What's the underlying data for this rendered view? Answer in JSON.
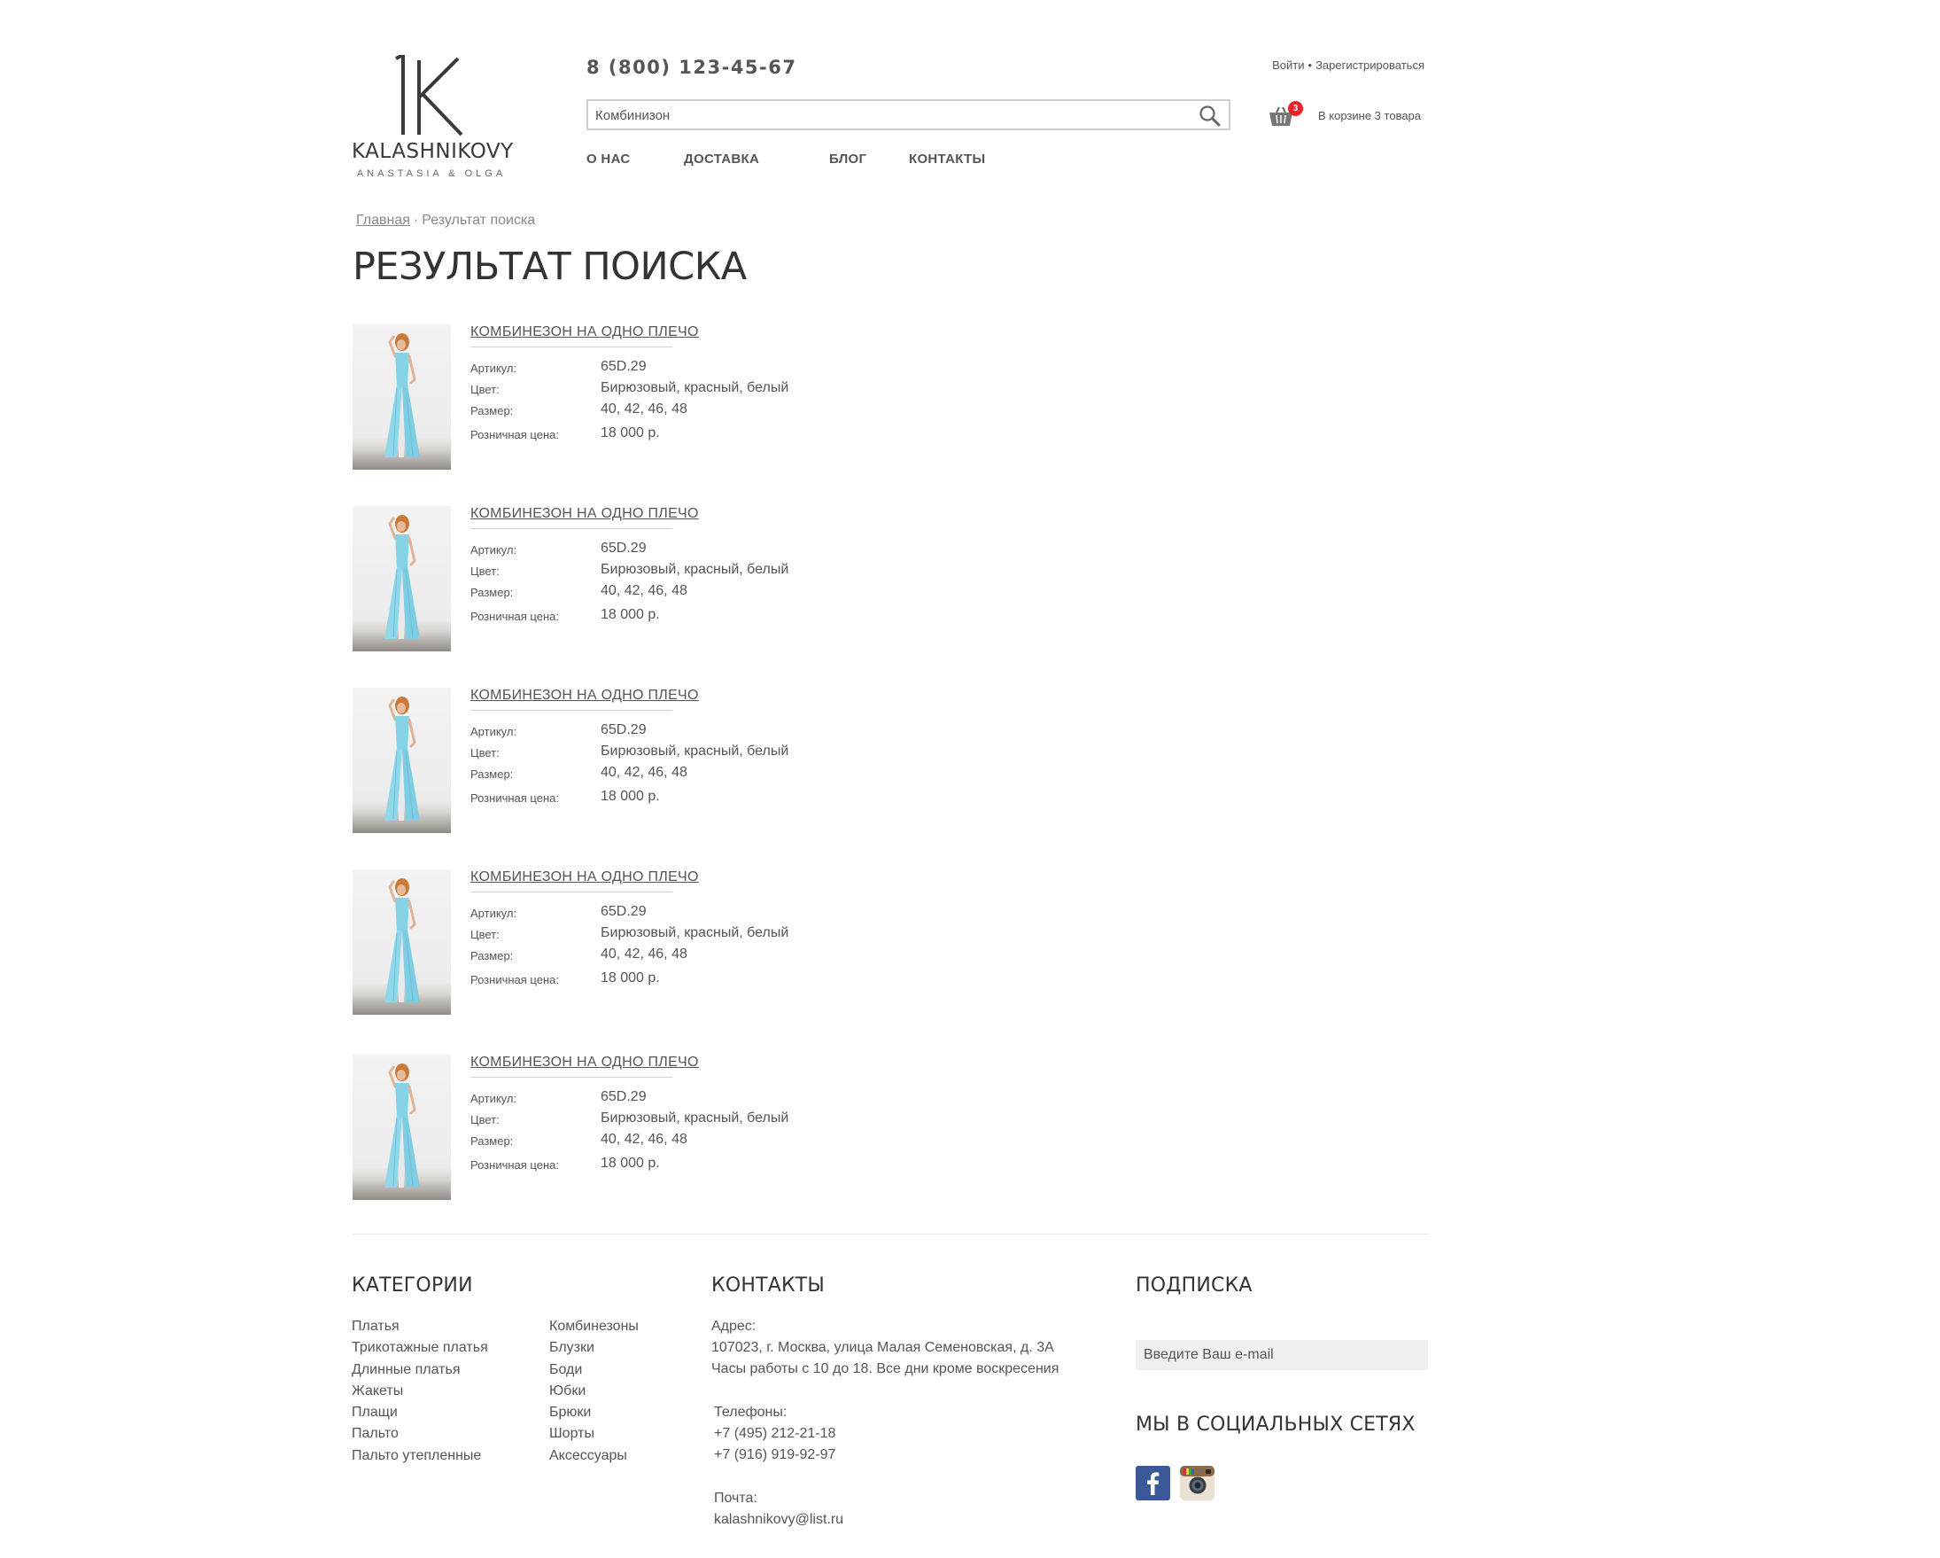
{
  "header": {
    "logo": {
      "name": "KALASHNIKOVY",
      "subtitle": "ANASTASIA & OLGA"
    },
    "phone": "8 (800) 123-45-67",
    "search": {
      "value": "Комбинизон",
      "icon": "search-icon"
    },
    "nav": [
      "О НАС",
      "ДОСТАВКА",
      "БЛОГ",
      "КОНТАКТЫ"
    ],
    "auth": {
      "login": "Войти",
      "separator": "•",
      "register": "Зарегистрироваться"
    },
    "cart": {
      "count": "3",
      "label": "В корзине 3 товара",
      "icon": "basket-icon",
      "badge_color": "#e8232a"
    }
  },
  "breadcrumb": {
    "home": "Главная",
    "separator": "·",
    "current": "Результат поиска"
  },
  "page_title": "РЕЗУЛЬТАТ ПОИСКА",
  "labels": {
    "article": "Артикул:",
    "color": "Цвет:",
    "size": "Размер:",
    "price": "Розничная цена:"
  },
  "products": [
    {
      "title": "КОМБИНЕЗОН НА ОДНО ПЛЕЧО",
      "article": "65D.29",
      "color": "Бирюзовый, красный, белый",
      "size": "40, 42, 46, 48",
      "price": "18 000 р."
    },
    {
      "title": "КОМБИНЕЗОН НА ОДНО ПЛЕЧО",
      "article": "65D.29",
      "color": "Бирюзовый, красный, белый",
      "size": "40, 42, 46, 48",
      "price": "18 000 р."
    },
    {
      "title": "КОМБИНЕЗОН НА ОДНО ПЛЕЧО",
      "article": "65D.29",
      "color": "Бирюзовый, красный, белый",
      "size": "40, 42, 46, 48",
      "price": "18 000 р."
    },
    {
      "title": "КОМБИНЕЗОН НА ОДНО ПЛЕЧО",
      "article": "65D.29",
      "color": "Бирюзовый, красный, белый",
      "size": "40, 42, 46, 48",
      "price": "18 000 р."
    },
    {
      "title": "КОМБИНЕЗОН НА ОДНО ПЛЕЧО",
      "article": "65D.29",
      "color": "Бирюзовый, красный, белый",
      "size": "40, 42, 46, 48",
      "price": "18 000 р."
    }
  ],
  "footer": {
    "categories": {
      "heading": "КАТЕГОРИИ",
      "col1": [
        "Платья",
        "Трикотажные платья",
        "Длинные платья",
        "Жакеты",
        "Плащи",
        "Пальто",
        "Пальто утепленные"
      ],
      "col2": [
        "Комбинезоны",
        "Блузки",
        "Боди",
        "Юбки",
        "Брюки",
        "Шорты",
        "Аксессуары"
      ]
    },
    "contacts": {
      "heading": "КОНТАКТЫ",
      "address_label": "Адрес:",
      "address": "107023, г. Москва, улица Малая Семеновская, д. 3А",
      "hours": "Часы работы с 10 до 18. Все дни кроме воскресения",
      "phones_label": "Телефоны:",
      "phone1": "+7 (495) 212-21-18",
      "phone2": "+7 (916) 919-92-97",
      "mail_label": "Почта:",
      "mail": "kalashnikovy@list.ru"
    },
    "subscribe": {
      "heading": "ПОДПИСКА",
      "placeholder": "Введите Ваш e-mail"
    },
    "social": {
      "heading": "МЫ В СОЦИАЛЬНЫХ СЕТЯХ",
      "icons": [
        "facebook-icon",
        "instagram-icon"
      ],
      "facebook_color": "#3b5998"
    }
  }
}
